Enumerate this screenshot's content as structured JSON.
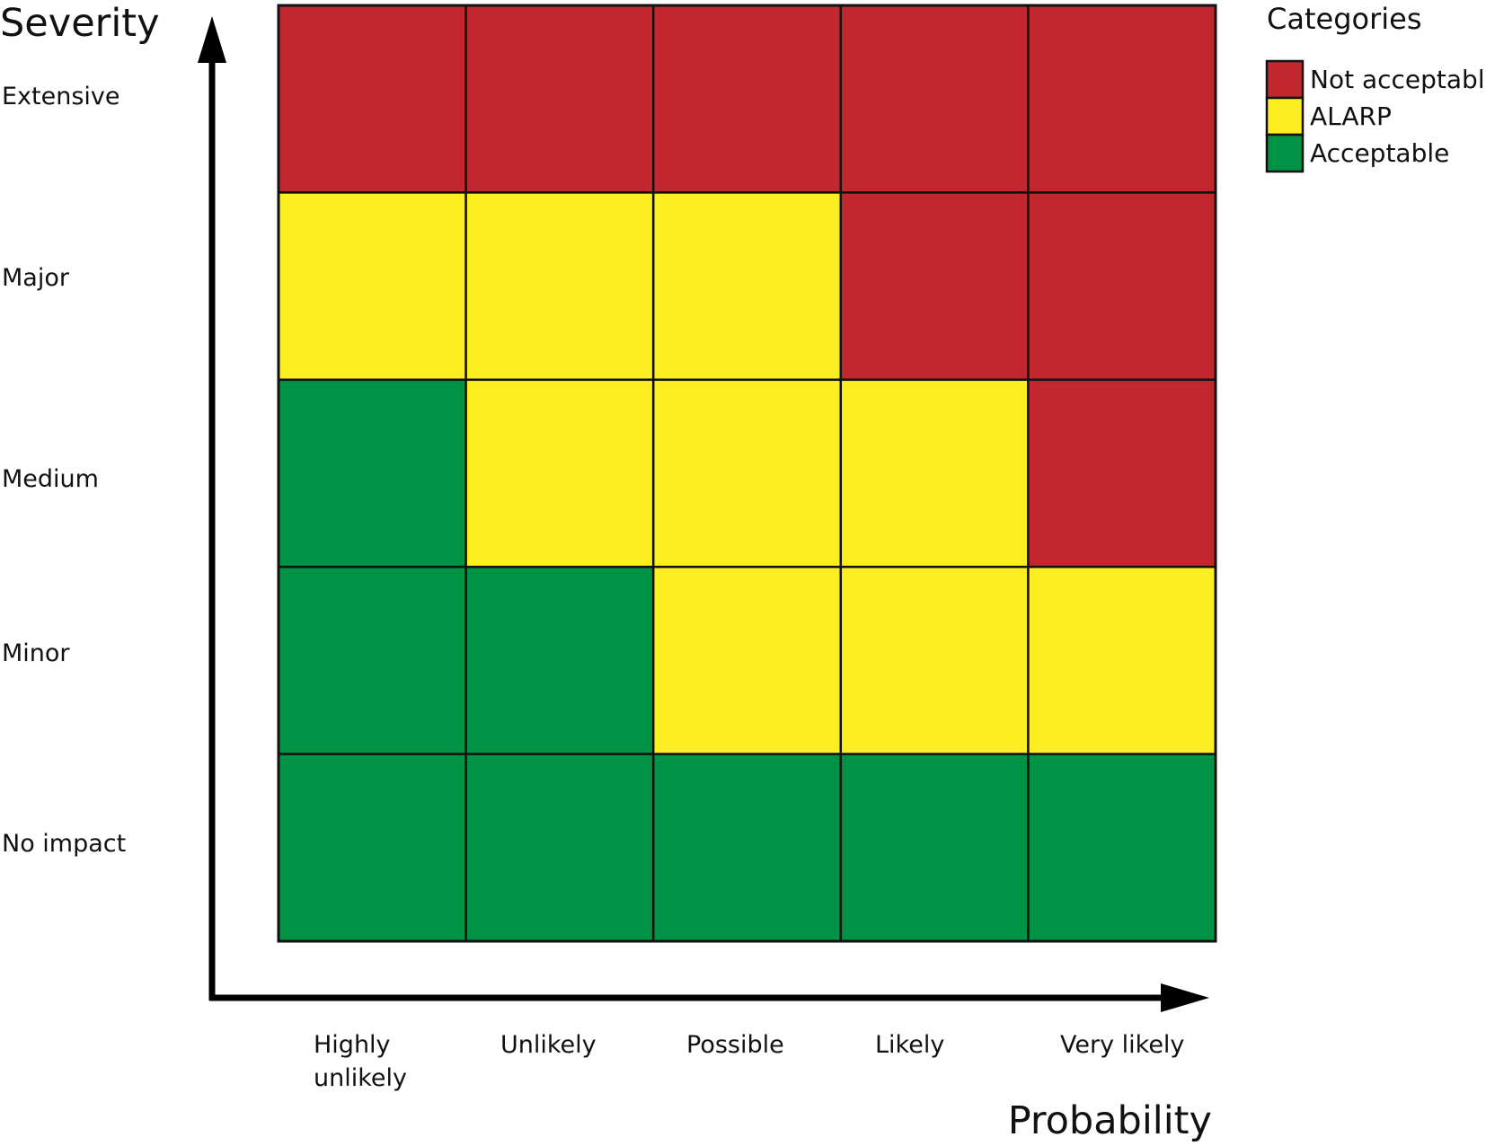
{
  "chart_data": {
    "type": "heatmap",
    "title": "",
    "ylabel": "Severity",
    "xlabel": "Probability",
    "x_categories": [
      "Highly unlikely",
      "Unlikely",
      "Possible",
      "Likely",
      "Very likely"
    ],
    "x_category_lines": [
      [
        "Highly",
        "unlikely"
      ],
      [
        "Unlikely"
      ],
      [
        "Possible"
      ],
      [
        "Likely"
      ],
      [
        "Very likely"
      ]
    ],
    "y_categories_top_to_bottom": [
      "Extensive",
      "Major",
      "Medium",
      "Minor",
      "No impact"
    ],
    "cells_top_to_bottom": [
      [
        "Not acceptable",
        "Not acceptable",
        "Not acceptable",
        "Not acceptable",
        "Not acceptable"
      ],
      [
        "ALARP",
        "ALARP",
        "ALARP",
        "Not acceptable",
        "Not acceptable"
      ],
      [
        "Acceptable",
        "ALARP",
        "ALARP",
        "ALARP",
        "Not acceptable"
      ],
      [
        "Acceptable",
        "Acceptable",
        "ALARP",
        "ALARP",
        "ALARP"
      ],
      [
        "Acceptable",
        "Acceptable",
        "Acceptable",
        "Acceptable",
        "Acceptable"
      ]
    ],
    "legend": {
      "title": "Categories",
      "position": "top-right",
      "entries": [
        {
          "label": "Not acceptable",
          "color": "#c1272d"
        },
        {
          "label": "ALARP",
          "color": "#fcee21"
        },
        {
          "label": "Acceptable",
          "color": "#009245"
        }
      ]
    },
    "grid": true
  }
}
